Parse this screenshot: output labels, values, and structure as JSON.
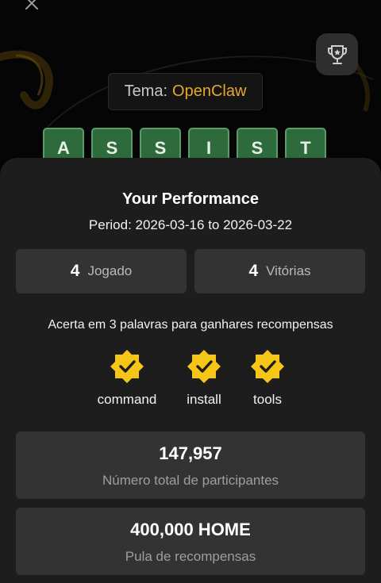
{
  "header": {
    "close_icon": "close-icon",
    "trophy_icon": "trophy-icon"
  },
  "theme": {
    "label": "Tema:",
    "value": "OpenClaw",
    "accent_color": "#e7a82a"
  },
  "tiles": [
    "A",
    "S",
    "S",
    "I",
    "S",
    "T"
  ],
  "tile_color": "#2e6b3c",
  "performance": {
    "title": "Your Performance",
    "period": "Period: 2026-03-16 to 2026-03-22",
    "played_count": "4",
    "played_label": "Jogado",
    "wins_count": "4",
    "wins_label": "Vitórias"
  },
  "rewards": {
    "note": "Acerta em 3 palavras para ganhares recompensas",
    "badge_color": "#f5c518",
    "words": [
      "command",
      "install",
      "tools"
    ]
  },
  "participants": {
    "value": "147,957",
    "label": "Número total de participantes"
  },
  "pool": {
    "value": "400,000 HOME",
    "label": "Pula de recompensas"
  }
}
